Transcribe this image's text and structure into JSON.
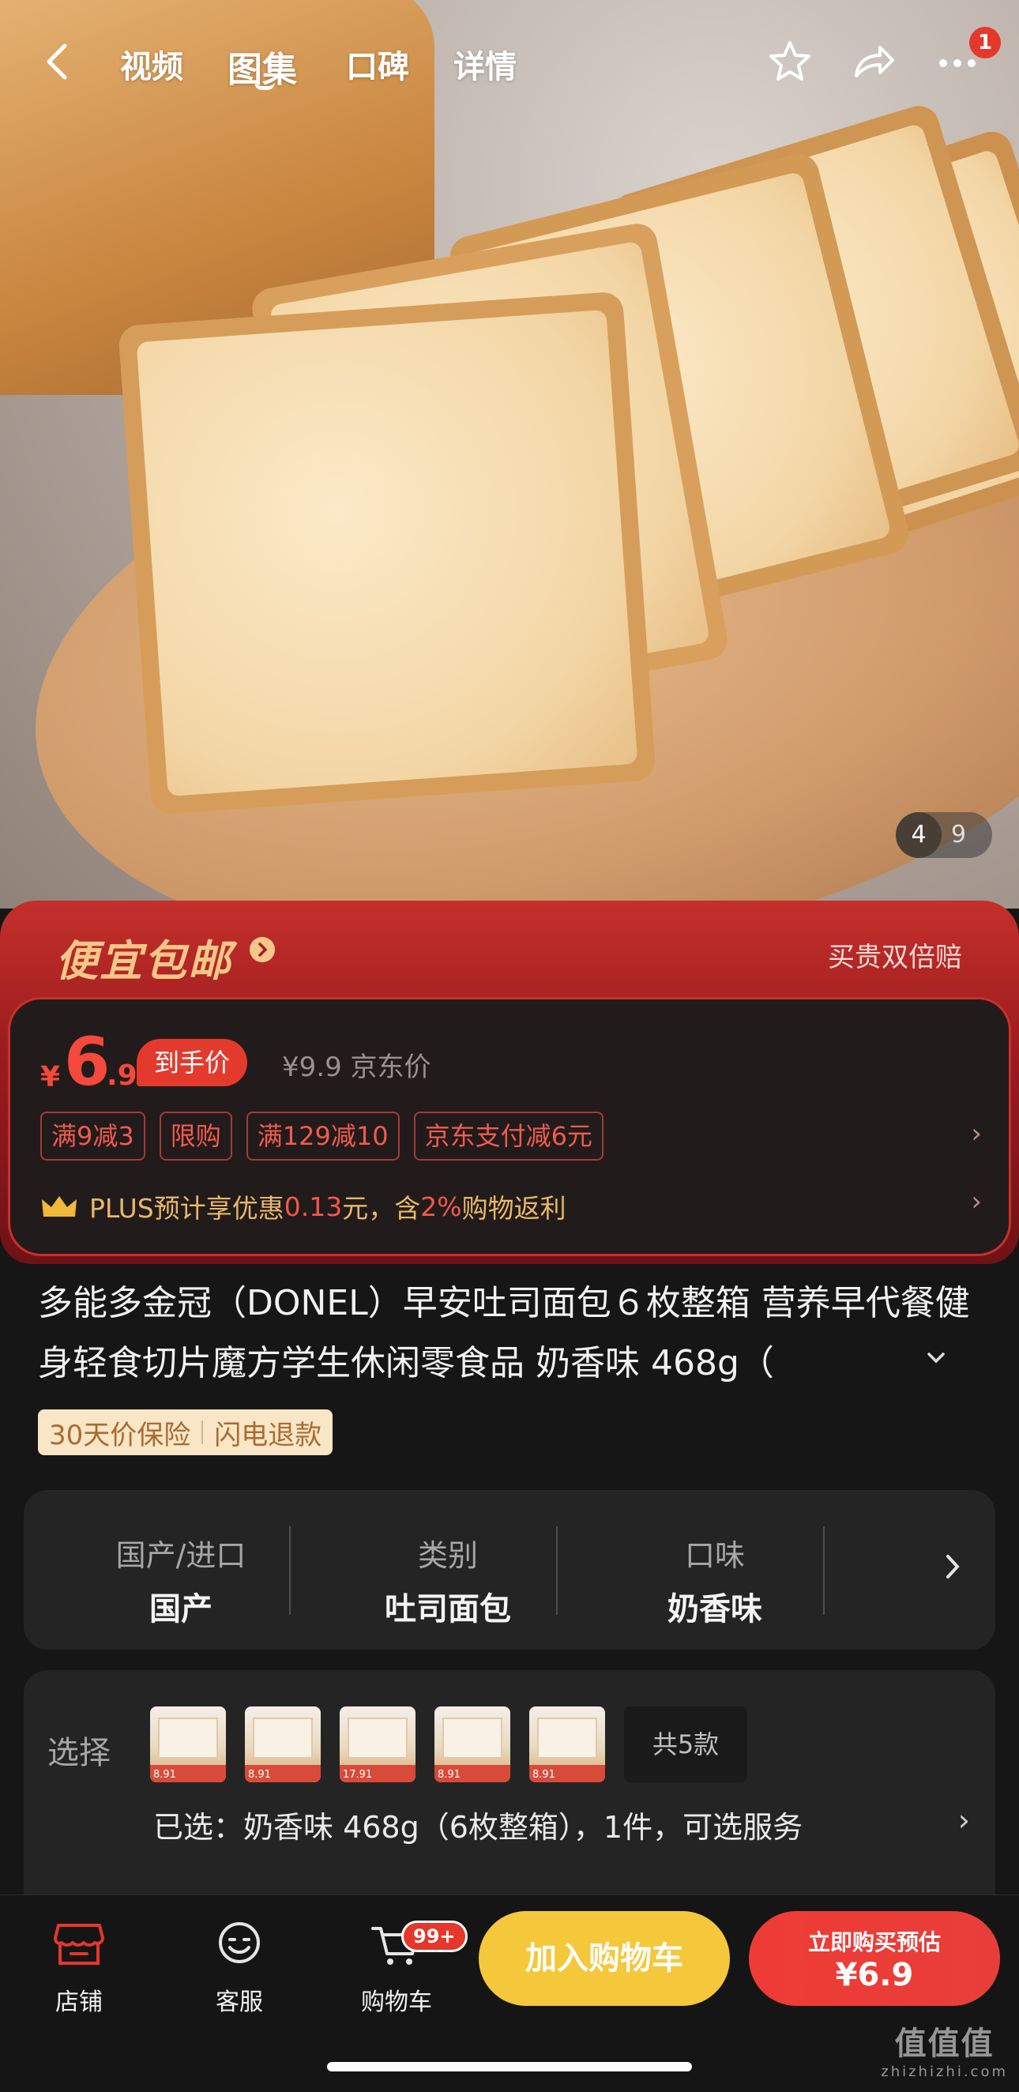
{
  "nav": {
    "tabs": [
      "视频",
      "图集",
      "口碑",
      "详情"
    ],
    "active_tab": "图集",
    "notification_count": "1"
  },
  "gallery": {
    "current": "4",
    "total": "9"
  },
  "promo": {
    "title": "便宜包邮",
    "guarantee": "买贵双倍赔",
    "currency": "¥",
    "price_int": "6",
    "price_dec": ".9",
    "price_tag": "到手价",
    "jd_price": "¥9.9 京东价",
    "coupons": [
      "满9减3",
      "限购",
      "满129减10",
      "京东支付减6元"
    ],
    "plus_prefix": "PLUS预计享优惠",
    "plus_amount": "0.13",
    "plus_mid": "元，含",
    "plus_pct": "2%",
    "plus_suffix": "购物返利",
    "accent": "#f4493b"
  },
  "product": {
    "title": "多能多金冠（DONEL）早安吐司面包６枚整箱 营养早代餐健身轻食切片魔方学生休闲零食品 奶香味 468g（",
    "badges": [
      "30天价保险",
      "闪电退款"
    ]
  },
  "specs": [
    {
      "label": "国产/进口",
      "value": "国产"
    },
    {
      "label": "类别",
      "value": "吐司面包"
    },
    {
      "label": "口味",
      "value": "奶香味"
    }
  ],
  "variants": {
    "label": "选择",
    "thumb_labels": [
      "8.91",
      "8.91",
      "17.91",
      "8.91",
      "8.91"
    ],
    "total": "共5款",
    "selected": "已选：奶香味 468g（6枚整箱），1件，可选服务"
  },
  "bottom": {
    "store": "店铺",
    "service": "客服",
    "cart": "购物车",
    "cart_badge": "99+",
    "add_to_cart": "加入购物车",
    "buy_line1": "立即购买预估",
    "buy_line2": "¥6.9",
    "cart_btn_color": "#f5c73a",
    "buy_btn_color": "#ef3b35"
  },
  "watermark": {
    "main": "值值值",
    "sub": "zhizhizhi.com"
  }
}
